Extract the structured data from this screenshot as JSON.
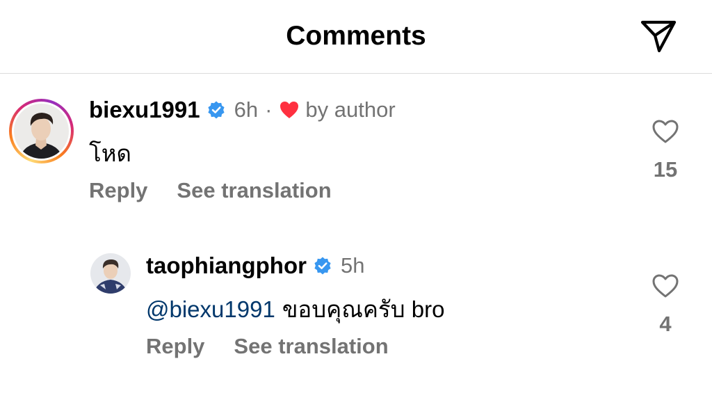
{
  "header": {
    "title": "Comments",
    "share_icon": "paper-plane-icon"
  },
  "colors": {
    "verified": "#3897f0",
    "liked_heart": "#ff3040",
    "mention": "#00376b",
    "secondary_text": "#737373"
  },
  "comments": [
    {
      "username": "biexu1991",
      "verified": true,
      "time": "6h",
      "separator": "·",
      "liked_by_author_label": "by author",
      "text": "โหด",
      "reply_label": "Reply",
      "translate_label": "See translation",
      "like_count": "15"
    },
    {
      "username": "taophiangphor",
      "verified": true,
      "time": "5h",
      "mention": "@biexu1991",
      "text": "ขอบคุณครับ bro",
      "reply_label": "Reply",
      "translate_label": "See translation",
      "like_count": "4"
    }
  ]
}
